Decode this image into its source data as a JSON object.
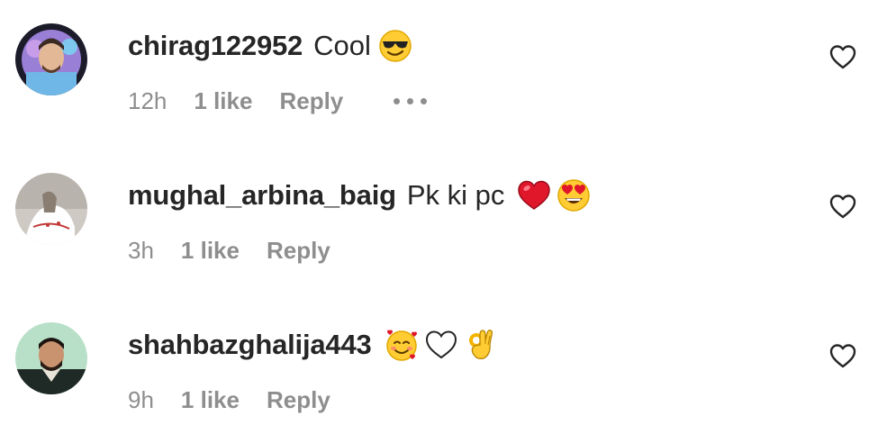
{
  "comments": [
    {
      "username": "chirag122952",
      "text": "Cool",
      "emojis": [
        "sunglasses-face"
      ],
      "time": "12h",
      "likes": "1 like",
      "reply": "Reply",
      "has_more": true
    },
    {
      "username": "mughal_arbina_baig",
      "text": "Pk ki pc",
      "emojis": [
        "red-heart",
        "heart-eyes-face"
      ],
      "time": "3h",
      "likes": "1 like",
      "reply": "Reply",
      "has_more": false
    },
    {
      "username": "shahbazghalija443",
      "text": "",
      "emojis": [
        "smiling-face-with-hearts",
        "white-heart",
        "ok-hand"
      ],
      "time": "9h",
      "likes": "1 like",
      "reply": "Reply",
      "has_more": false
    }
  ],
  "colors": {
    "username": "#262626",
    "meta": "#8e8e8e",
    "heart_outline": "#262626",
    "red_heart": "#e0162b",
    "emoji_yellow": "#ffcc33"
  }
}
